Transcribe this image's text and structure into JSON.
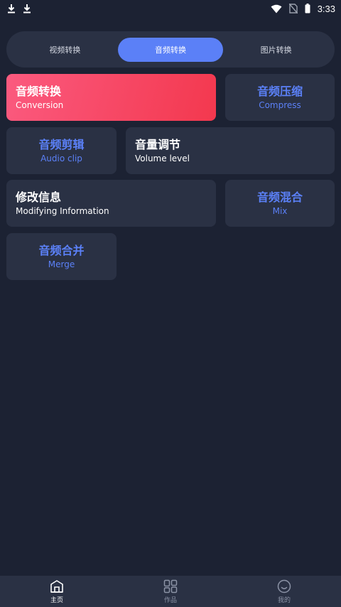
{
  "status_bar": {
    "time": "3:33"
  },
  "tabs": [
    {
      "label": "视频转换",
      "active": false
    },
    {
      "label": "音频转换",
      "active": true
    },
    {
      "label": "图片转换",
      "active": false
    }
  ],
  "cards": {
    "conversion": {
      "title": "音频转换",
      "subtitle": "Conversion"
    },
    "compress": {
      "title": "音频压缩",
      "subtitle": "Compress"
    },
    "audio_clip": {
      "title": "音频剪辑",
      "subtitle": "Audio clip"
    },
    "volume_level": {
      "title": "音量调节",
      "subtitle": "Volume level"
    },
    "modifying_info": {
      "title": "修改信息",
      "subtitle": "Modifying Information"
    },
    "mix": {
      "title": "音频混合",
      "subtitle": "Mix"
    },
    "merge": {
      "title": "音频合并",
      "subtitle": "Merge"
    }
  },
  "bottom_nav": [
    {
      "label": "主页",
      "icon": "home-icon",
      "active": true
    },
    {
      "label": "作品",
      "icon": "grid-icon",
      "active": false
    },
    {
      "label": "我的",
      "icon": "smile-icon",
      "active": false
    }
  ],
  "colors": {
    "background": "#1c2233",
    "card": "#2a3144",
    "accent": "#5b80f7",
    "primary_gradient_start": "#fb5a7f",
    "primary_gradient_end": "#f3384e"
  }
}
